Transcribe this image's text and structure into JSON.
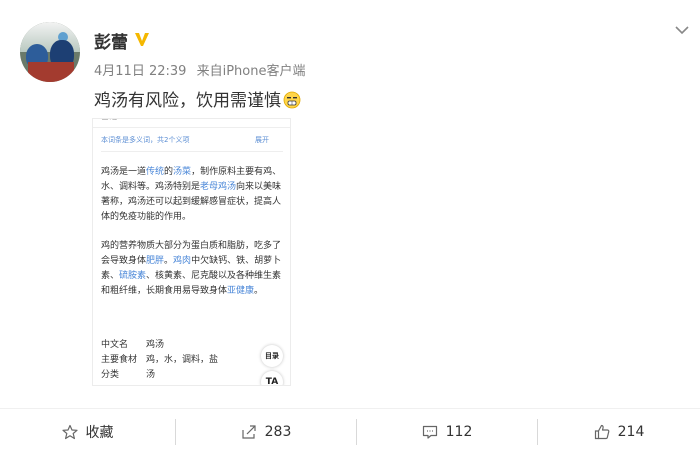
{
  "post": {
    "author": "彭蕾",
    "verified_icon": "verified-v-icon",
    "date": "4月11日 22:39",
    "source_prefix": "来自",
    "source": "iPhone客户端",
    "text": "鸡汤有风险，饮用需谨慎",
    "emoji": "grimace-emoji-icon"
  },
  "screenshot": {
    "section_title": "基础",
    "note": "本词条是多义词，共2个义项",
    "expand": "展开",
    "para1": {
      "parts": [
        "鸡汤是一道",
        "传统",
        "的",
        "汤菜",
        "，制作原料主要有鸡、水、调料等。鸡汤特别是",
        "老母鸡汤",
        "向来以美味著称，鸡汤还可以起到缓解感冒症状，提高人体的免疫功能的作用。"
      ]
    },
    "para2": {
      "parts": [
        "鸡的营养物质大部分为蛋白质和脂肪，吃多了会导致身体",
        "肥胖",
        "。",
        "鸡肉",
        "中欠缺钙、铁、胡萝卜素、",
        "硫胺素",
        "、核黄素、尼克酸以及各种维生素和粗纤维，长期食用易导致身体",
        "亚健康",
        "。"
      ]
    },
    "table": [
      {
        "k": "中文名",
        "v": "鸡汤"
      },
      {
        "k": "主要食材",
        "v": "鸡，水，调料，盐"
      },
      {
        "k": "分类",
        "v": "汤"
      }
    ],
    "toc_label": "目录",
    "ta_label": "TA"
  },
  "actions": {
    "favorite": "收藏",
    "repost": "283",
    "comment": "112",
    "like": "214"
  },
  "colors": {
    "link": "#4a87d8",
    "meta": "#808080",
    "verified": "#f5b800"
  }
}
